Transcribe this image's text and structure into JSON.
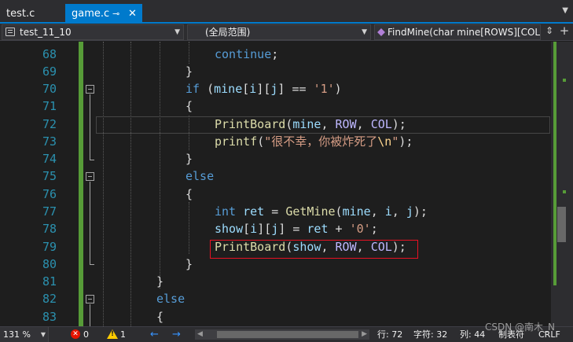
{
  "tabs": [
    {
      "label": "test.c",
      "active": false
    },
    {
      "label": "game.c",
      "active": true,
      "pin_glyph": "⊸",
      "close_glyph": "✕"
    }
  ],
  "nav": {
    "project": "test_11_10",
    "scope": "(全局范围)",
    "function": "FindMine(char mine[ROWS][COLS"
  },
  "editor": {
    "line_numbers": [
      "68",
      "69",
      "70",
      "71",
      "72",
      "73",
      "74",
      "75",
      "76",
      "77",
      "78",
      "79",
      "80",
      "81",
      "82",
      "83"
    ],
    "l68": {
      "continue": "continue",
      "semi": ";"
    },
    "l69": {
      "brace": "}"
    },
    "l70": {
      "kw_if": "if",
      "open": " (",
      "arr": "mine",
      "idx1": "[",
      "i": "i",
      "idx2": "][",
      "j": "j",
      "idx3": "]",
      "op": " == ",
      "char": "'1'",
      "close": ")"
    },
    "l71": {
      "brace": "{"
    },
    "l72": {
      "fn": "PrintBoard",
      "open": "(",
      "a1": "mine",
      "c1": ", ",
      "m1": "ROW",
      "c2": ", ",
      "m2": "COL",
      "close": ");"
    },
    "l73": {
      "fn": "printf",
      "open": "(",
      "str": "\"很不幸，你被炸死了",
      "esc": "\\n",
      "strend": "\"",
      "close": ");"
    },
    "l74": {
      "brace": "}"
    },
    "l75": {
      "kw_else": "else"
    },
    "l76": {
      "brace": "{"
    },
    "l77": {
      "kw_int": "int",
      "var": " ret",
      "eq": " = ",
      "fn": "GetMine",
      "open": "(",
      "a1": "mine",
      "c1": ", ",
      "a2": "i",
      "c2": ", ",
      "a3": "j",
      "close": ");"
    },
    "l78": {
      "arr": "show",
      "idx1": "[",
      "i": "i",
      "idx2": "][",
      "j": "j",
      "idx3": "]",
      "eq": " = ",
      "var": "ret",
      "plus": " + ",
      "char": "'0'",
      "semi": ";"
    },
    "l79": {
      "fn": "PrintBoard",
      "open": "(",
      "a1": "show",
      "c1": ", ",
      "m1": "ROW",
      "c2": ", ",
      "m2": "COL",
      "close": ");"
    },
    "l80": {
      "brace": "}"
    },
    "l81": {
      "brace": "}"
    },
    "l82": {
      "kw_else": "else"
    },
    "l83": {
      "brace": "{"
    }
  },
  "status": {
    "zoom": "131 %",
    "errors": "0",
    "warnings": "1",
    "back_arrow": "←",
    "forward_arrow": "→",
    "line": "行: 72",
    "char": "字符: 32",
    "col": "列: 44",
    "tabs": "制表符",
    "eol": "CRLF"
  },
  "watermark": "CSDN @南木_N",
  "colors": {
    "accent": "#007acc",
    "change_bar": "#579c38",
    "highlight_box": "#e81123"
  }
}
